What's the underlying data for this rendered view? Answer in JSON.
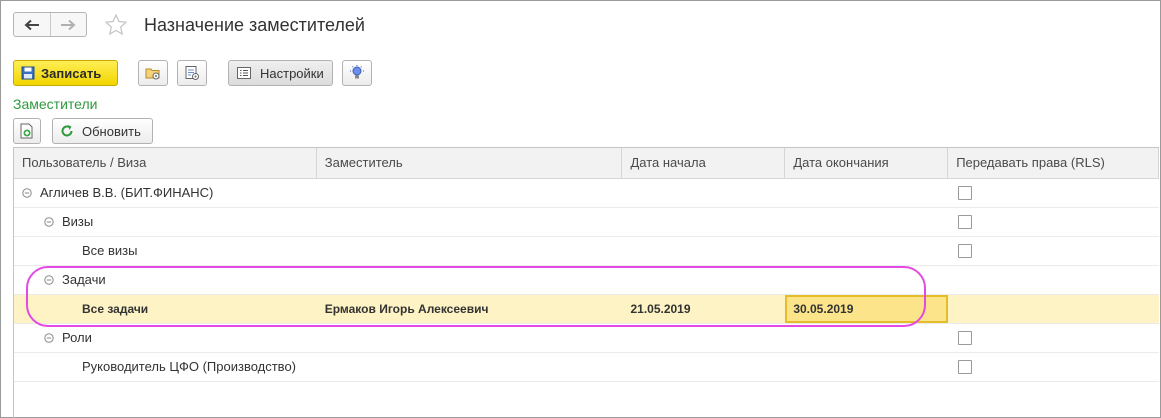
{
  "window": {
    "title": "Назначение заместителей"
  },
  "toolbar": {
    "save_label": "Записать",
    "settings_label": "Настройки"
  },
  "section": {
    "title": "Заместители",
    "refresh_label": "Обновить"
  },
  "table": {
    "columns": [
      "Пользователь / Виза",
      "Заместитель",
      "Дата начала",
      "Дата окончания",
      "Передавать права (RLS)"
    ],
    "rows": [
      {
        "user": "Агличев В.В. (БИТ.ФИНАНС)",
        "deputy": "",
        "start": "",
        "end": "",
        "rls": false
      },
      {
        "user": "Визы",
        "deputy": "",
        "start": "",
        "end": "",
        "rls": false
      },
      {
        "user": "Все визы",
        "deputy": "",
        "start": "",
        "end": "",
        "rls": false
      },
      {
        "user": "Задачи",
        "deputy": "",
        "start": "",
        "end": ""
      },
      {
        "user": "Все задачи",
        "deputy": "Ермаков Игорь Алексеевич",
        "start": "21.05.2019",
        "end": "30.05.2019"
      },
      {
        "user": "Роли",
        "deputy": "",
        "start": "",
        "end": "",
        "rls": false
      },
      {
        "user": "Руководитель ЦФО (Производство)",
        "deputy": "",
        "start": "",
        "end": "",
        "rls": false
      }
    ]
  },
  "colors": {
    "save_button": "#f5dc1a",
    "section_title": "#2e9a3c",
    "selected_row": "#fdf3c4",
    "highlight_outline": "#e34ae3"
  },
  "icons": [
    "back-arrow-icon",
    "forward-arrow-icon",
    "star-icon",
    "floppy-disk-icon",
    "folder-gear-icon",
    "list-gear-icon",
    "settings-list-icon",
    "lightbulb-icon",
    "add-document-icon",
    "refresh-icon",
    "collapse-icon"
  ]
}
